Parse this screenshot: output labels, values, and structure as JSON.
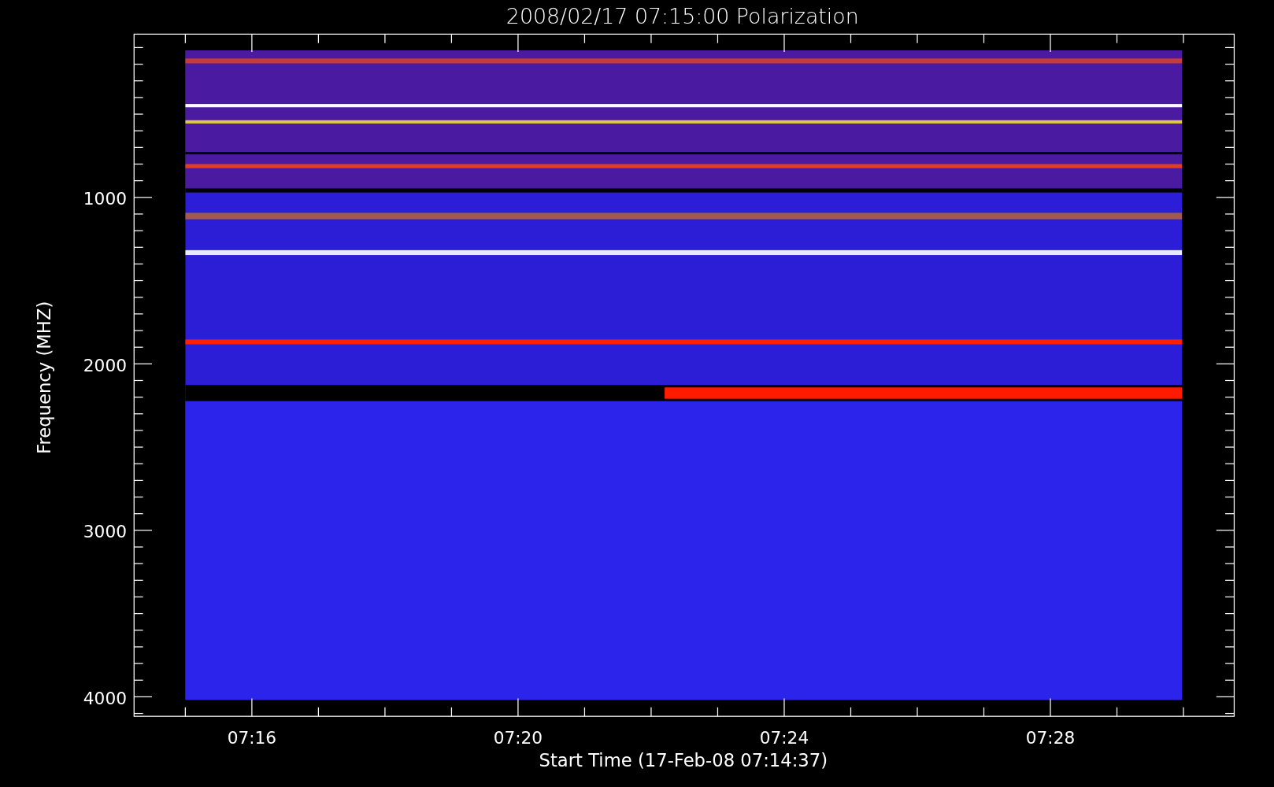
{
  "title": "2008/02/17 07:15:00 Polarization",
  "y_axis": {
    "label": "Frequency (MHZ)",
    "tick_labels": [
      "1000",
      "2000",
      "3000",
      "4000"
    ]
  },
  "x_axis": {
    "label": "Start Time (17-Feb-08 07:14:37)",
    "tick_labels": [
      "07:16",
      "07:20",
      "07:24",
      "07:28"
    ]
  }
}
